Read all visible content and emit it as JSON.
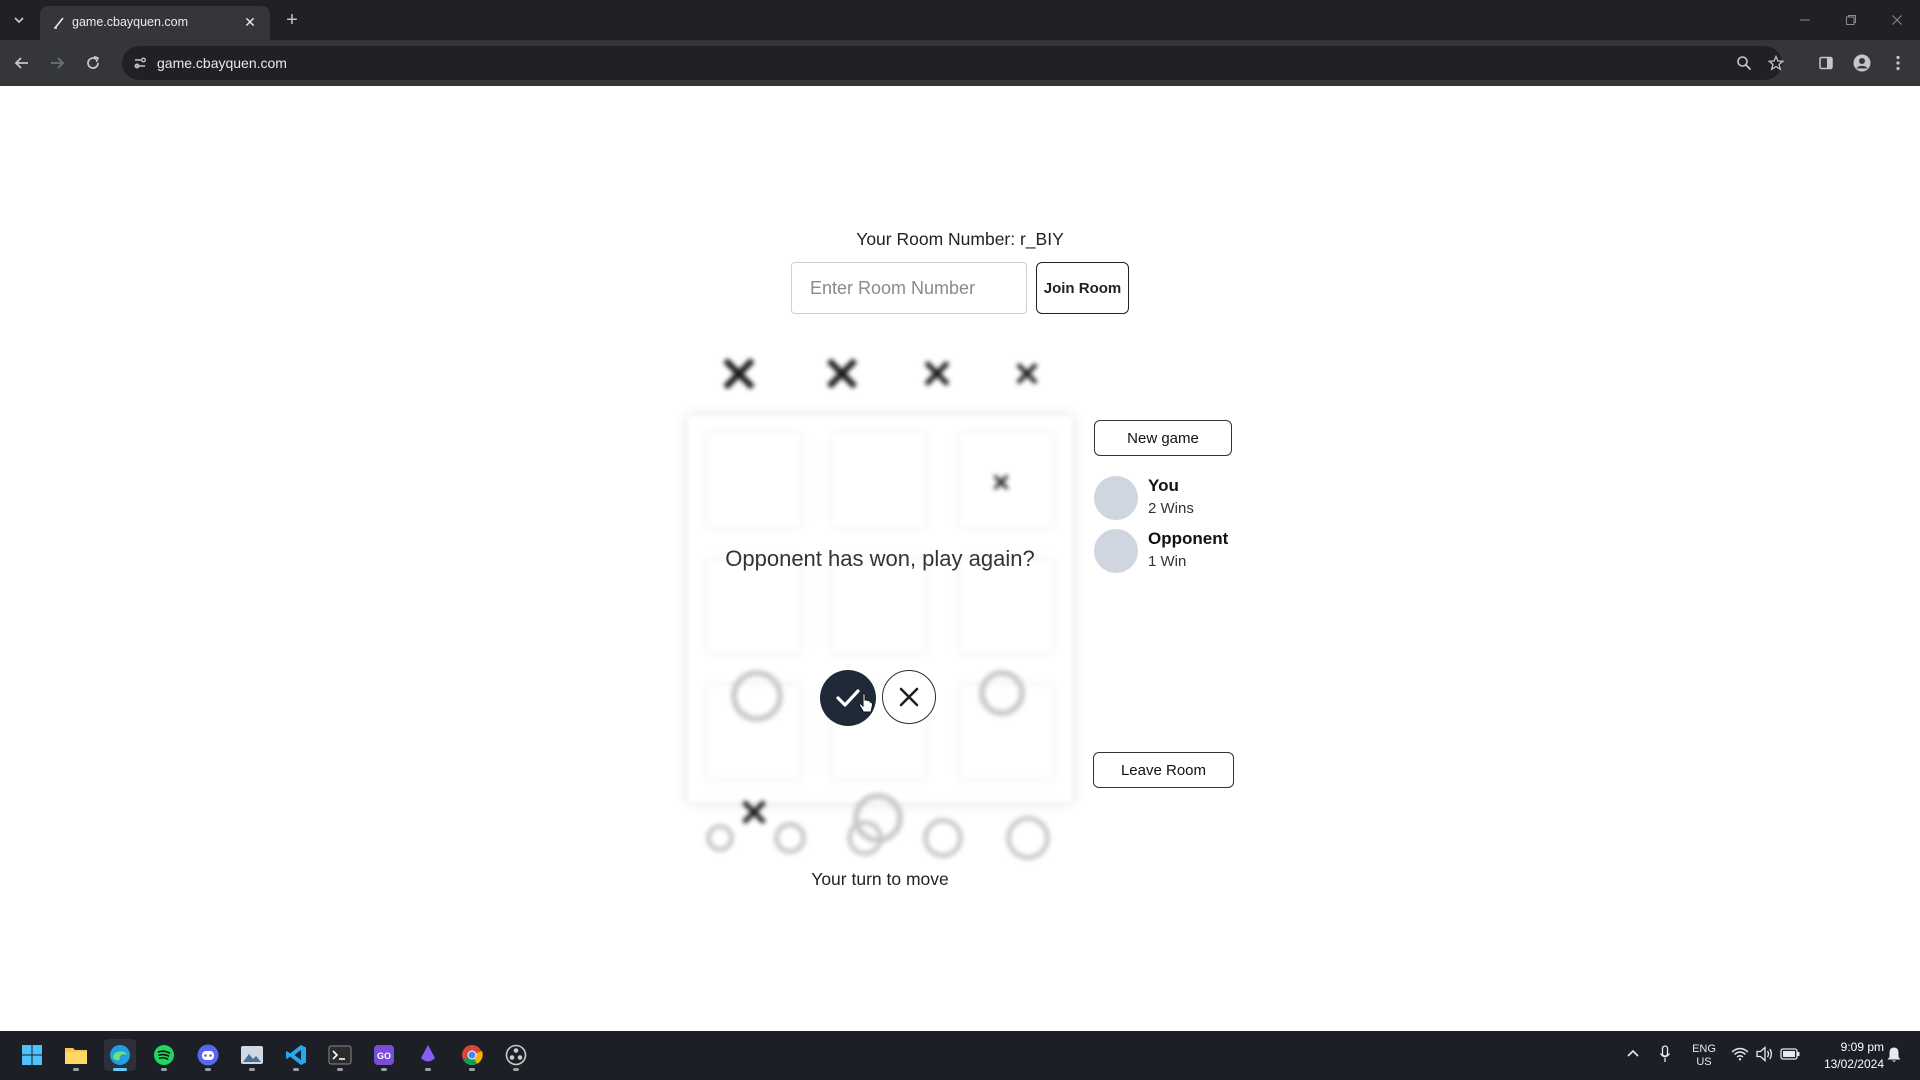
{
  "browser": {
    "tab_title": "game.cbayquen.com",
    "url": "game.cbayquen.com",
    "new_tab_symbol": "+",
    "tab_close_symbol": "✕"
  },
  "room": {
    "label": "Your Room Number: r_BIY",
    "input_placeholder": "Enter Room Number",
    "join_label": "Join Room"
  },
  "dialog": {
    "text": "Opponent has won, play again?"
  },
  "sidebar": {
    "new_game_label": "New game",
    "leave_label": "Leave Room",
    "players": [
      {
        "name": "You",
        "wins": "2 Wins"
      },
      {
        "name": "Opponent",
        "wins": "1 Win"
      }
    ]
  },
  "status": {
    "turn_text": "Your turn to move"
  },
  "taskbar": {
    "language": "ENG",
    "region": "US",
    "time": "9:09 pm",
    "date": "13/02/2024"
  },
  "colors": {
    "accept_button": "#1f2937",
    "avatar": "#cfd6e0",
    "browser_dark": "#202124"
  }
}
